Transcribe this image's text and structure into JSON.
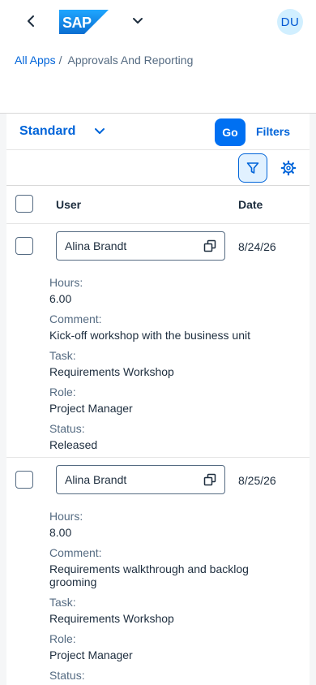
{
  "shell": {
    "logo_text": "SAP",
    "avatar_initials": "DU"
  },
  "breadcrumb": {
    "root": "All Apps",
    "separator": "/",
    "current": "Approvals And Reporting"
  },
  "filterbar": {
    "variant": "Standard",
    "go_label": "Go",
    "filters_label": "Filters"
  },
  "table": {
    "columns": [
      "User",
      "Date"
    ],
    "rows": [
      {
        "user": "Alina Brandt",
        "date": "8/24/26",
        "hours_label": "Hours:",
        "hours": "6.00",
        "comment_label": "Comment:",
        "comment": "Kick-off workshop with the business unit",
        "task_label": "Task:",
        "task": "Requirements Workshop",
        "role_label": "Role:",
        "role": "Project Manager",
        "status_label": "Status:",
        "status": "Released"
      },
      {
        "user": "Alina Brandt",
        "date": "8/25/26",
        "hours_label": "Hours:",
        "hours": "8.00",
        "comment_label": "Comment:",
        "comment": "Requirements walkthrough and backlog grooming",
        "task_label": "Task:",
        "task": "Requirements Workshop",
        "role_label": "Role:",
        "role": "Project Manager",
        "status_label": "Status:"
      }
    ]
  },
  "icons": {
    "back": "chevron-left-icon",
    "menu": "chevron-down-icon",
    "variant": "chevron-down-icon",
    "filter": "funnel-icon",
    "settings": "gear-icon",
    "copy": "copy-icon"
  },
  "colors": {
    "brand_blue": "#0070f2",
    "link_blue": "#0064d9",
    "avatar_bg": "#d1efff",
    "text": "#1d2d3e",
    "label": "#556b82"
  }
}
